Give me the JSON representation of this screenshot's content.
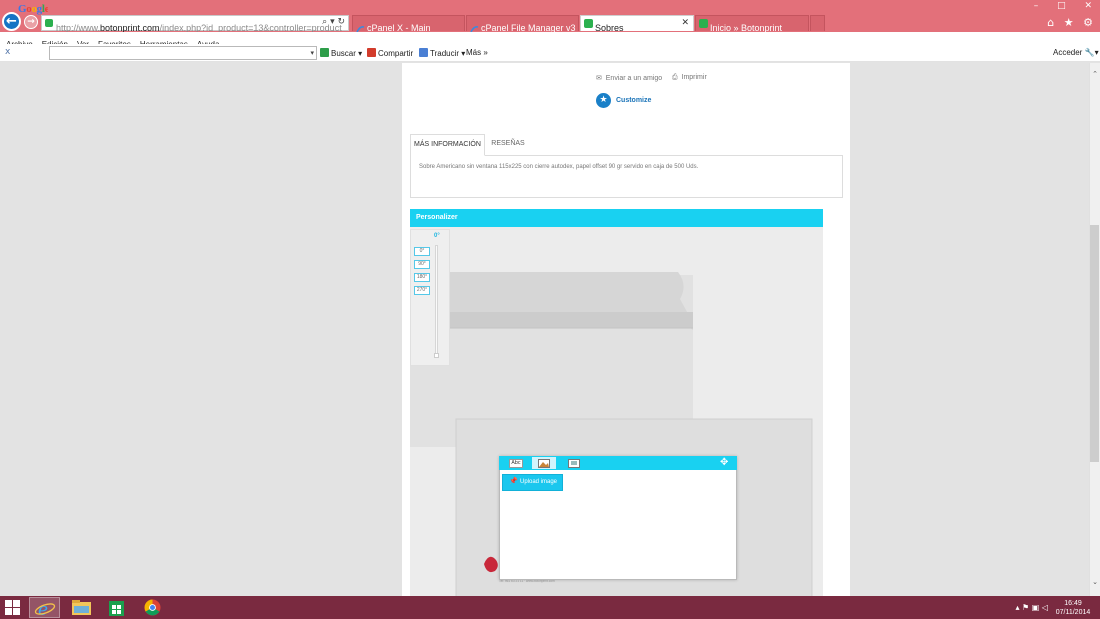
{
  "browser": {
    "address_url_prefix": "http://www.",
    "address_url_host": "botonprint.com",
    "address_url_path": "/index.php?id_product=13&controller=product",
    "address_tools": "⌕ ▾ ↻",
    "tabs": [
      {
        "label": "cPanel X - Main"
      },
      {
        "label": "cPanel File Manager v3"
      },
      {
        "label": "Sobres",
        "active": true
      },
      {
        "label": "Inicio » Botonprint"
      }
    ],
    "tab_close": "✕",
    "window_controls": {
      "minimize": "–",
      "maximize": "□",
      "close": "✕"
    },
    "home_icon": "⌂",
    "favorites_icon": "★",
    "settings_icon": "⚙"
  },
  "menu": {
    "items": [
      "Archivo",
      "Edición",
      "Ver",
      "Favoritos",
      "Herramientas",
      "Ayuda"
    ]
  },
  "google_toolbar": {
    "close": "x",
    "search_value": "",
    "buscar": "Buscar ▾",
    "compartir": "Compartir",
    "traducir": "Traducir ▾",
    "mas": "Más »",
    "acceder": "Acceder",
    "wrench": "▾"
  },
  "product": {
    "send_friend": "Enviar a un amigo",
    "print": "Imprimir",
    "customize": "Customize",
    "tab_more_info": "MÁS INFORMACIÓN",
    "tab_reviews": "RESEÑAS",
    "description": "Sobre Americano sin ventana 115x225 con cierre autodex, papel offset 90 gr servido en caja de 500 Uds.",
    "personalizer_title": "Personalizer"
  },
  "designer": {
    "rotation_value": "0°",
    "rotation_buttons": [
      "0°",
      "90°",
      "180°",
      "270°"
    ],
    "upload_image_label": "Upload image",
    "tab_text_label": "Abc",
    "envelope_small_text": "Tel: 961 63 21 11 · www.botonprint.com"
  },
  "taskbar": {
    "time": "16:49",
    "date": "07/11/2014",
    "tray_icons": "▴ ⚑ ▣ ◁"
  },
  "colors": {
    "titlebar": "#e3707a",
    "accent_cyan": "#19d1f1",
    "taskbar": "#7a2a40",
    "customize_blue": "#1a80c8"
  }
}
